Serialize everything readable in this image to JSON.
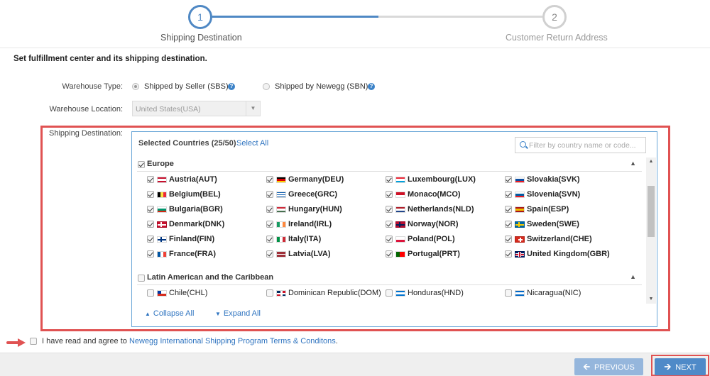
{
  "stepper": {
    "steps": [
      {
        "number": "1",
        "label": "Shipping Destination"
      },
      {
        "number": "2",
        "label": "Customer Return Address"
      }
    ]
  },
  "section_title": "Set fulfillment center and its shipping destination.",
  "warehouse_type": {
    "label": "Warehouse Type:",
    "options": [
      {
        "label": "Shipped by Seller (SBS)",
        "checked": true
      },
      {
        "label": "Shipped by Newegg (SBN)",
        "checked": false
      }
    ],
    "help_icon": "question-icon"
  },
  "warehouse_location": {
    "label": "Warehouse Location:",
    "value": "United States(USA)"
  },
  "shipping_destination": {
    "label": "Shipping Destination:",
    "selected_text": "Selected Countries (25/50)",
    "select_all": "Select All",
    "filter_placeholder": "Filter by country name or code...",
    "collapse_all": "Collapse All",
    "expand_all": "Expand All",
    "regions": [
      {
        "name": "Europe",
        "checked": true,
        "countries": [
          {
            "name": "Austria(AUT)",
            "checked": true
          },
          {
            "name": "Germany(DEU)",
            "checked": true
          },
          {
            "name": "Luxembourg(LUX)",
            "checked": true
          },
          {
            "name": "Slovakia(SVK)",
            "checked": true
          },
          {
            "name": "Belgium(BEL)",
            "checked": true
          },
          {
            "name": "Greece(GRC)",
            "checked": true
          },
          {
            "name": "Monaco(MCO)",
            "checked": true
          },
          {
            "name": "Slovenia(SVN)",
            "checked": true
          },
          {
            "name": "Bulgaria(BGR)",
            "checked": true
          },
          {
            "name": "Hungary(HUN)",
            "checked": true
          },
          {
            "name": "Netherlands(NLD)",
            "checked": true
          },
          {
            "name": "Spain(ESP)",
            "checked": true
          },
          {
            "name": "Denmark(DNK)",
            "checked": true
          },
          {
            "name": "Ireland(IRL)",
            "checked": true
          },
          {
            "name": "Norway(NOR)",
            "checked": true
          },
          {
            "name": "Sweden(SWE)",
            "checked": true
          },
          {
            "name": "Finland(FIN)",
            "checked": true
          },
          {
            "name": "Italy(ITA)",
            "checked": true
          },
          {
            "name": "Poland(POL)",
            "checked": true
          },
          {
            "name": "Switzerland(CHE)",
            "checked": true
          },
          {
            "name": "France(FRA)",
            "checked": true
          },
          {
            "name": "Latvia(LVA)",
            "checked": true
          },
          {
            "name": "Portugal(PRT)",
            "checked": true
          },
          {
            "name": "United Kingdom(GBR)",
            "checked": true
          }
        ]
      },
      {
        "name": "Latin American and the Caribbean",
        "checked": false,
        "countries": [
          {
            "name": "Chile(CHL)",
            "checked": false
          },
          {
            "name": "Dominican Republic(DOM)",
            "checked": false
          },
          {
            "name": "Honduras(HND)",
            "checked": false
          },
          {
            "name": "Nicaragua(NIC)",
            "checked": false
          }
        ]
      }
    ]
  },
  "agreement": {
    "prefix": "I have read and agree to ",
    "link": "Newegg International Shipping Program Terms & Conditons",
    "suffix": "."
  },
  "buttons": {
    "previous": "PREVIOUS",
    "next": "NEXT"
  },
  "colors": {
    "accent": "#4f88c4",
    "highlight": "#e05252",
    "link": "#2f74c0"
  }
}
